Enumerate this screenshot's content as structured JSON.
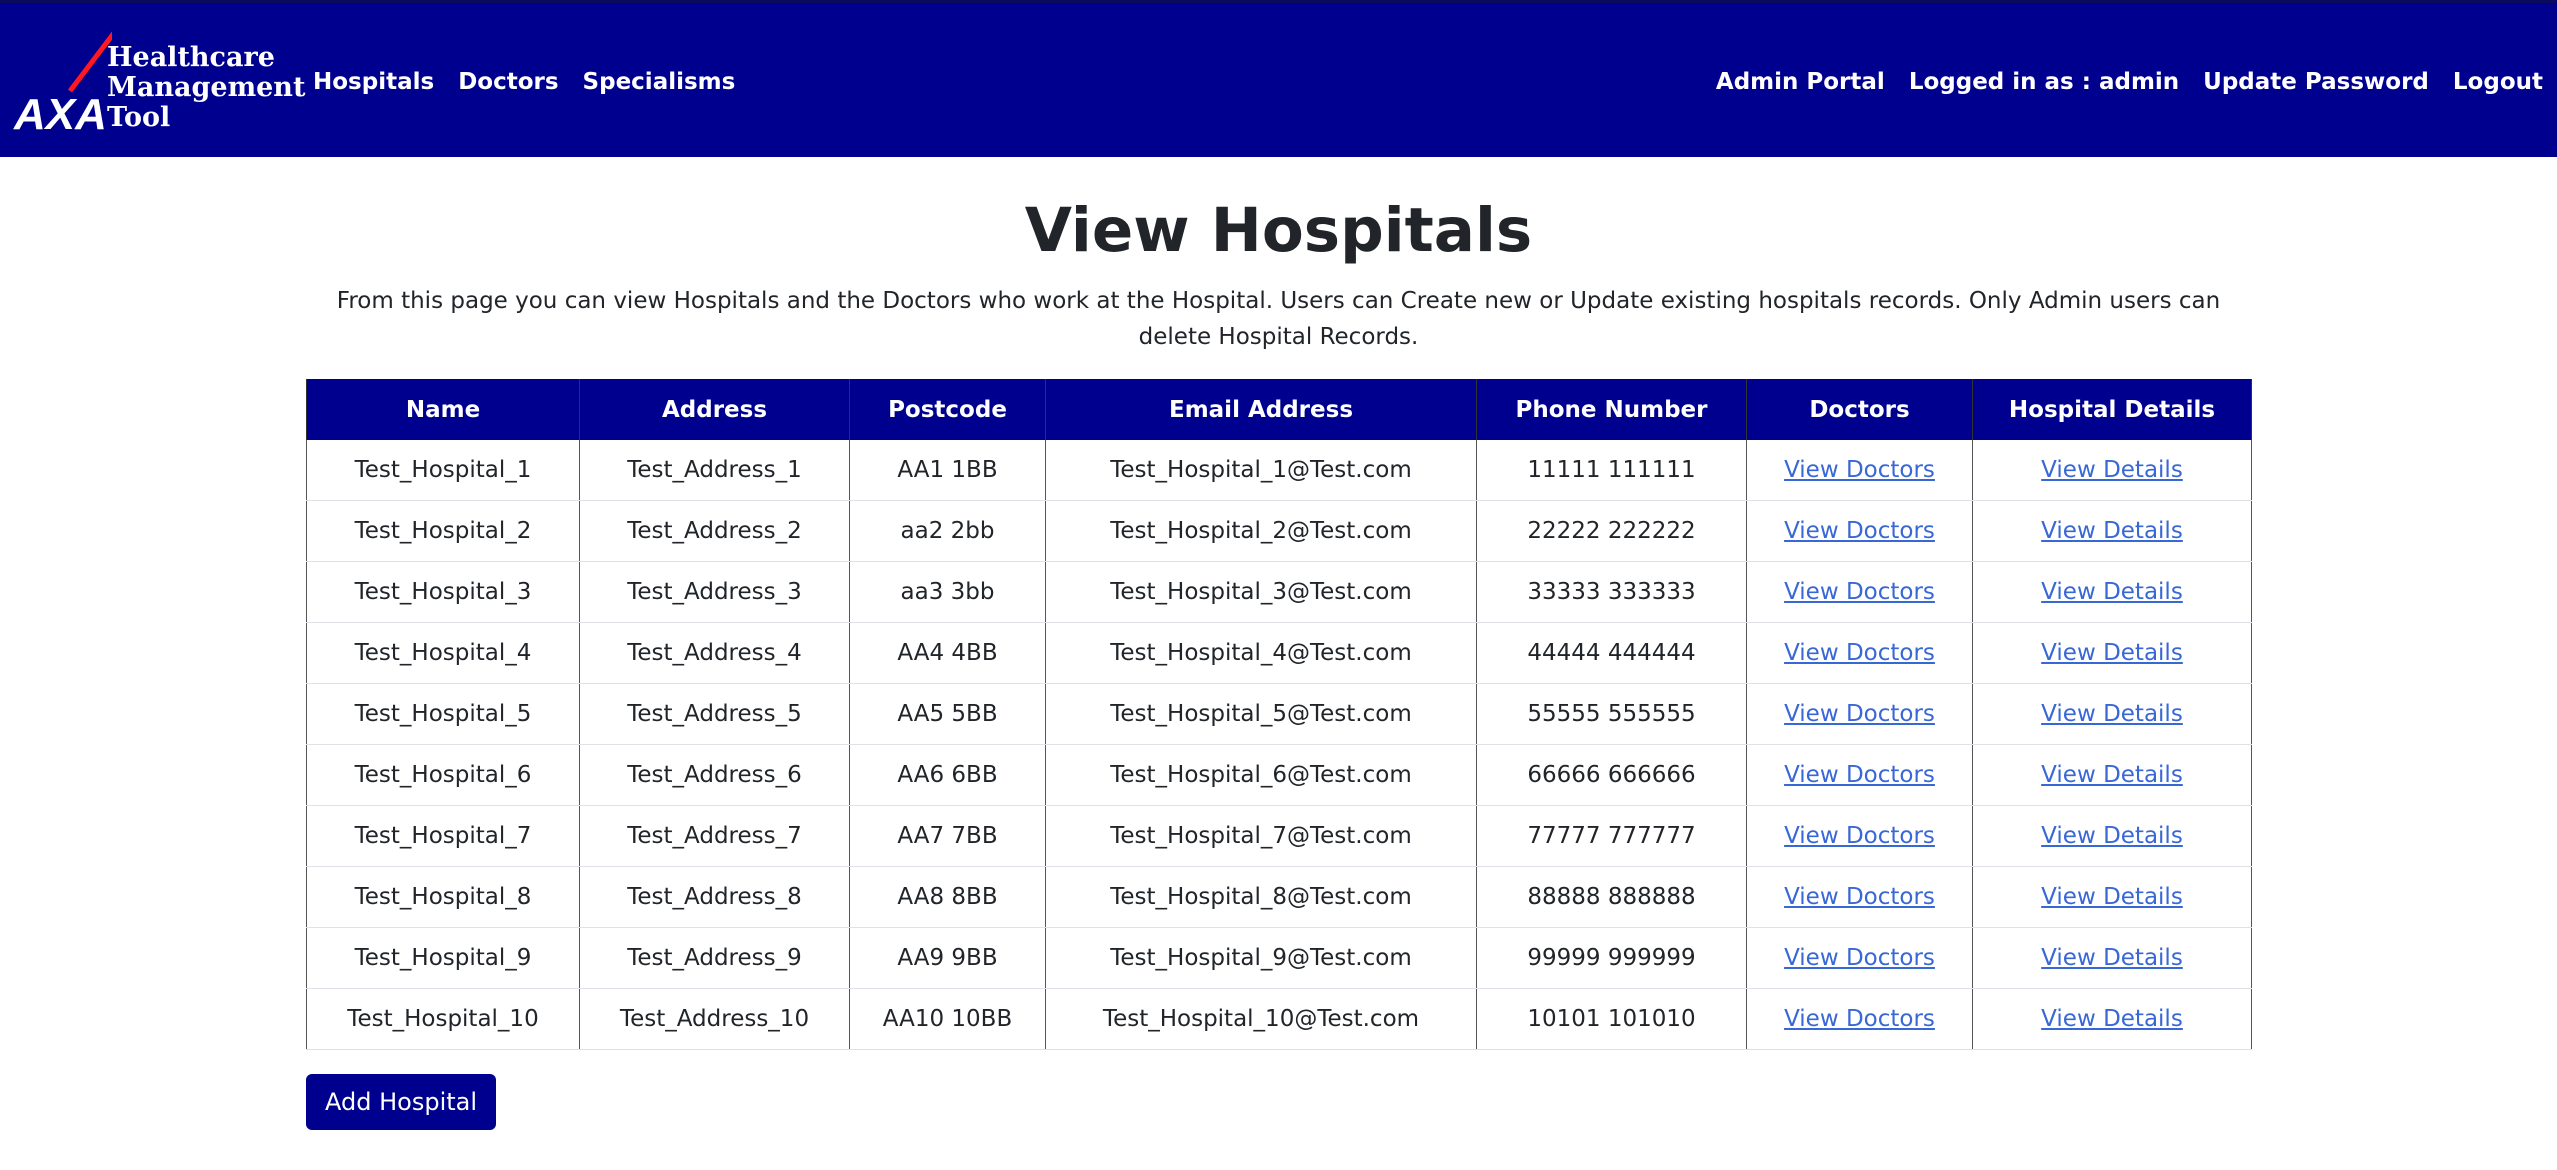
{
  "brand": {
    "logo_text": "AXA",
    "title": "Healthcare\nManagement\nTool"
  },
  "nav": {
    "left": [
      {
        "label": "Hospitals"
      },
      {
        "label": "Doctors"
      },
      {
        "label": "Specialisms"
      }
    ],
    "right": [
      {
        "label": "Admin Portal"
      },
      {
        "label": "Logged in as : admin"
      },
      {
        "label": "Update Password"
      },
      {
        "label": "Logout"
      }
    ]
  },
  "page": {
    "title": "View Hospitals",
    "description": "From this page you can view Hospitals and the Doctors who work at the Hospital. Users can Create new or Update existing hospitals records. Only Admin users can delete Hospital Records."
  },
  "table": {
    "columns": [
      "Name",
      "Address",
      "Postcode",
      "Email Address",
      "Phone Number",
      "Doctors",
      "Hospital Details"
    ],
    "rows": [
      {
        "name": "Test_Hospital_1",
        "address": "Test_Address_1",
        "postcode": "AA1 1BB",
        "email": "Test_Hospital_1@Test.com",
        "phone": "11111 111111",
        "doctors": "View Doctors",
        "details": "View Details"
      },
      {
        "name": "Test_Hospital_2",
        "address": "Test_Address_2",
        "postcode": "aa2 2bb",
        "email": "Test_Hospital_2@Test.com",
        "phone": "22222 222222",
        "doctors": "View Doctors",
        "details": "View Details"
      },
      {
        "name": "Test_Hospital_3",
        "address": "Test_Address_3",
        "postcode": "aa3 3bb",
        "email": "Test_Hospital_3@Test.com",
        "phone": "33333 333333",
        "doctors": "View Doctors",
        "details": "View Details"
      },
      {
        "name": "Test_Hospital_4",
        "address": "Test_Address_4",
        "postcode": "AA4 4BB",
        "email": "Test_Hospital_4@Test.com",
        "phone": "44444 444444",
        "doctors": "View Doctors",
        "details": "View Details"
      },
      {
        "name": "Test_Hospital_5",
        "address": "Test_Address_5",
        "postcode": "AA5 5BB",
        "email": "Test_Hospital_5@Test.com",
        "phone": "55555 555555",
        "doctors": "View Doctors",
        "details": "View Details"
      },
      {
        "name": "Test_Hospital_6",
        "address": "Test_Address_6",
        "postcode": "AA6 6BB",
        "email": "Test_Hospital_6@Test.com",
        "phone": "66666 666666",
        "doctors": "View Doctors",
        "details": "View Details"
      },
      {
        "name": "Test_Hospital_7",
        "address": "Test_Address_7",
        "postcode": "AA7 7BB",
        "email": "Test_Hospital_7@Test.com",
        "phone": "77777 777777",
        "doctors": "View Doctors",
        "details": "View Details"
      },
      {
        "name": "Test_Hospital_8",
        "address": "Test_Address_8",
        "postcode": "AA8 8BB",
        "email": "Test_Hospital_8@Test.com",
        "phone": "88888 888888",
        "doctors": "View Doctors",
        "details": "View Details"
      },
      {
        "name": "Test_Hospital_9",
        "address": "Test_Address_9",
        "postcode": "AA9 9BB",
        "email": "Test_Hospital_9@Test.com",
        "phone": "99999 999999",
        "doctors": "View Doctors",
        "details": "View Details"
      },
      {
        "name": "Test_Hospital_10",
        "address": "Test_Address_10",
        "postcode": "AA10 10BB",
        "email": "Test_Hospital_10@Test.com",
        "phone": "10101 101010",
        "doctors": "View Doctors",
        "details": "View Details"
      }
    ]
  },
  "add_button": {
    "label": "Add Hospital"
  },
  "colors": {
    "brand_blue": "#00008f",
    "logo_slash": "#ff1721",
    "link": "#3867d6"
  }
}
